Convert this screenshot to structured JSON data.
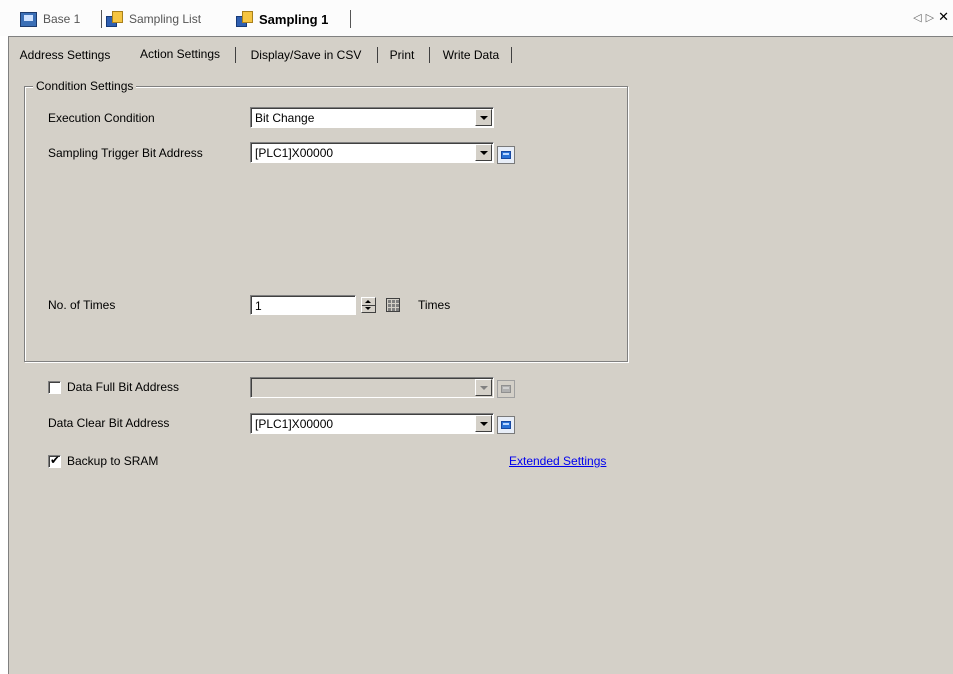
{
  "doc_tabs": [
    {
      "label": "Base 1",
      "icon": "monitor-icon"
    },
    {
      "label": "Sampling List",
      "icon": "sampling-icon"
    },
    {
      "label": "Sampling 1",
      "icon": "sampling-icon",
      "active": true
    }
  ],
  "window_nav": {
    "prev": "◁",
    "next": "▷",
    "close": "✕"
  },
  "settings_tabs": [
    {
      "label": "Address Settings"
    },
    {
      "label": "Action Settings",
      "selected": true
    },
    {
      "label": "Display/Save in CSV"
    },
    {
      "label": "Print"
    },
    {
      "label": "Write Data"
    }
  ],
  "condition_group": {
    "title": "Condition Settings",
    "execution_condition": {
      "label": "Execution Condition",
      "value": "Bit Change"
    },
    "trigger_address": {
      "label": "Sampling Trigger Bit Address",
      "value": "[PLC1]X00000"
    },
    "times": {
      "label": "No. of Times",
      "value": "1",
      "unit": "Times"
    }
  },
  "data_full": {
    "label": "Data Full Bit Address",
    "checked": false,
    "value": ""
  },
  "data_clear": {
    "label": "Data Clear Bit Address",
    "value": "[PLC1]X00000"
  },
  "backup_sram": {
    "label": "Backup to SRAM",
    "checked": true,
    "check_glyph": "✔"
  },
  "extended_link": "Extended Settings"
}
